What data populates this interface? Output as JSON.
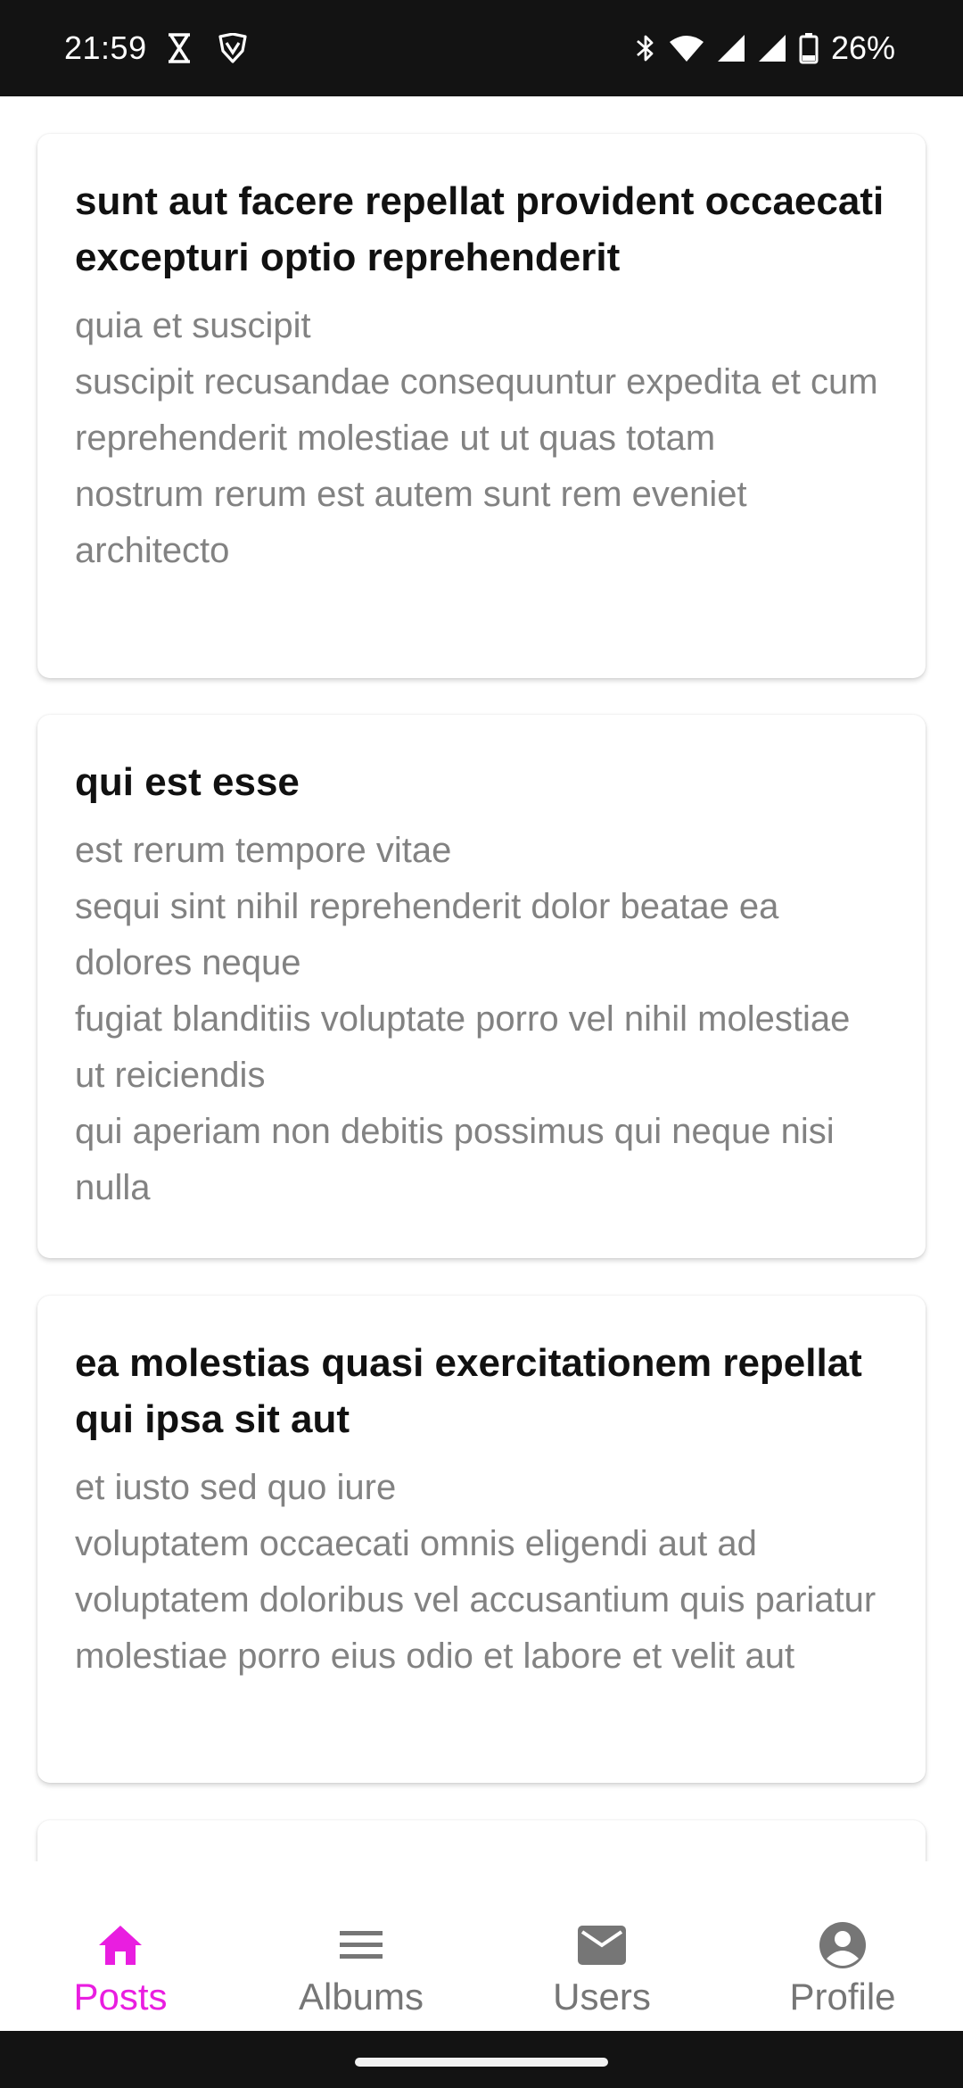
{
  "status_bar": {
    "time": "21:59",
    "battery": "26%",
    "left_icons": [
      "hourglass-icon",
      "vpn-shield-icon"
    ],
    "right_icons": [
      "bluetooth-icon",
      "wifi-icon",
      "signal-icon",
      "signal-icon",
      "battery-icon"
    ]
  },
  "posts": [
    {
      "title": "sunt aut facere repellat provident occaecati excepturi optio reprehenderit",
      "body": "quia et suscipit\nsuscipit recusandae consequuntur expedita et cum\nreprehenderit molestiae ut ut quas totam\nnostrum rerum est autem sunt rem eveniet architecto"
    },
    {
      "title": "qui est esse",
      "body": "est rerum tempore vitae\nsequi sint nihil reprehenderit dolor beatae ea dolores neque\nfugiat blanditiis voluptate porro vel nihil molestiae ut reiciendis\nqui aperiam non debitis possimus qui neque nisi nulla"
    },
    {
      "title": "ea molestias quasi exercitationem repellat qui ipsa sit aut",
      "body": "et iusto sed quo iure\nvoluptatem occaecati omnis eligendi aut ad\nvoluptatem doloribus vel accusantium quis pariatur\nmolestiae porro eius odio et labore et velit aut"
    }
  ],
  "bottom_nav": {
    "items": [
      {
        "label": "Posts",
        "icon": "home-icon",
        "active": true
      },
      {
        "label": "Albums",
        "icon": "menu-icon",
        "active": false
      },
      {
        "label": "Users",
        "icon": "mail-icon",
        "active": false
      },
      {
        "label": "Profile",
        "icon": "account-circle-icon",
        "active": false
      }
    ]
  },
  "colors": {
    "accent": "#E91EE0",
    "inactive": "#767676",
    "body_text": "#828282",
    "title_text": "#111111",
    "system_bar": "#131313"
  }
}
